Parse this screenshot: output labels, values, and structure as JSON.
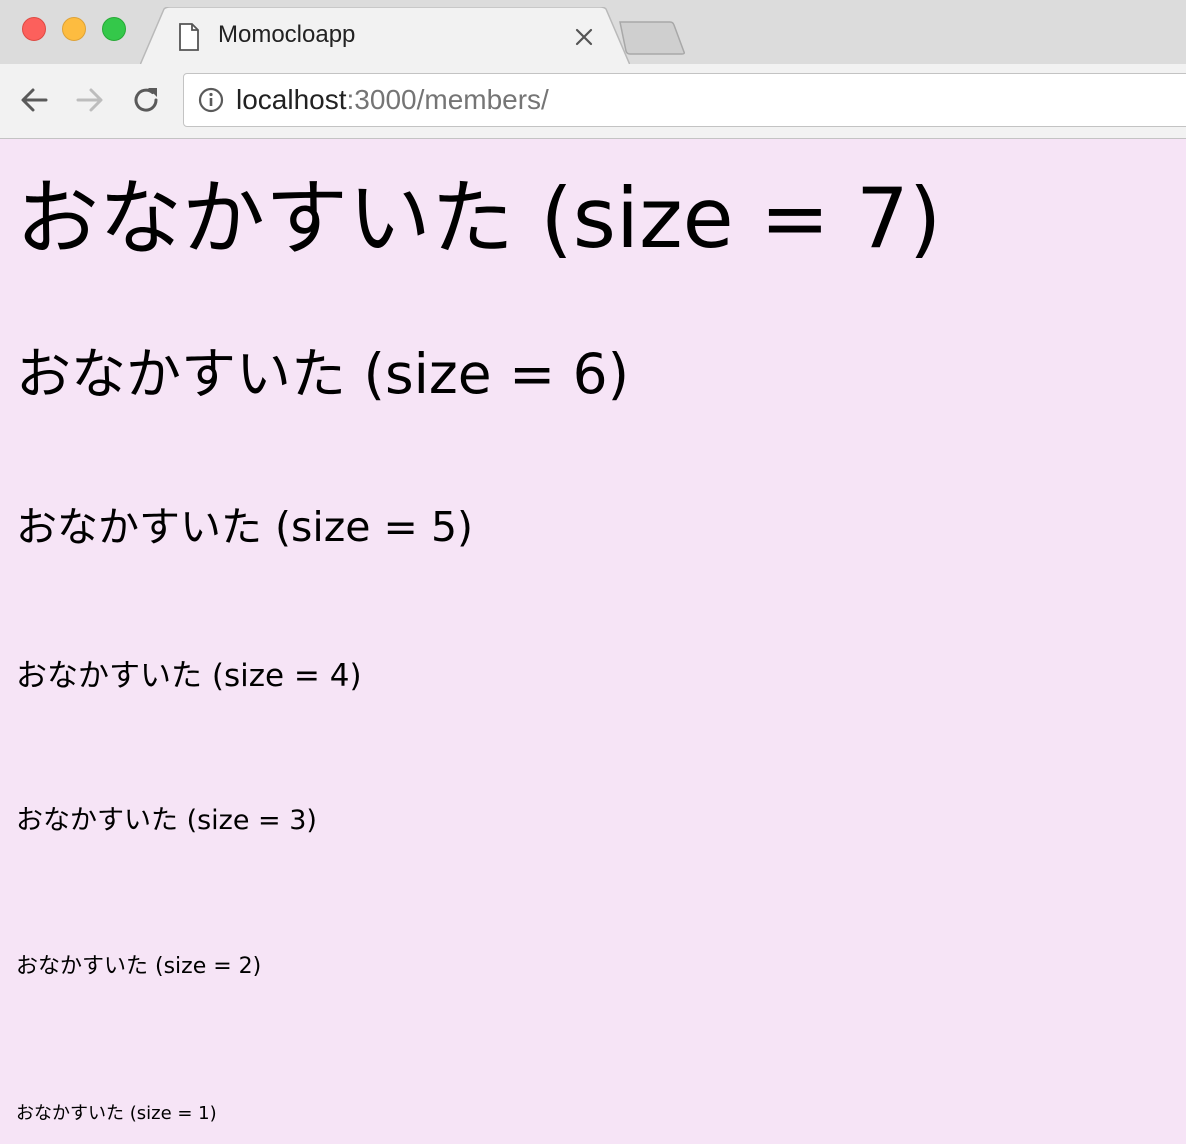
{
  "browser": {
    "tab": {
      "title": "Momocloapp",
      "icon": "page-icon"
    },
    "address_bar": {
      "host": "localhost",
      "rest": ":3000/members/"
    },
    "colors": {
      "close": "#fc605c",
      "minimize": "#fdbc40",
      "maximize": "#34c84a"
    }
  },
  "page": {
    "background": "#f6e4f6",
    "lines": [
      "おなかすいた (size = 7)",
      "おなかすいた (size = 6)",
      "おなかすいた (size = 5)",
      "おなかすいた (size = 4)",
      "おなかすいた (size = 3)",
      "おなかすいた (size = 2)",
      "おなかすいた (size = 1)"
    ]
  }
}
